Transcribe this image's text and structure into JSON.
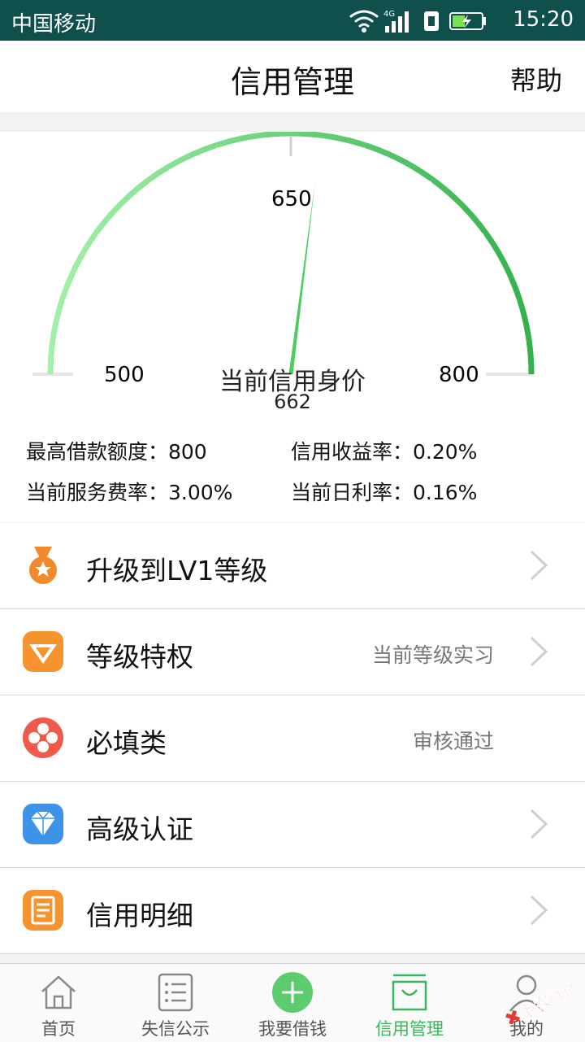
{
  "status_bar": {
    "carrier": "中国移动",
    "network": "4G",
    "time": "15:20"
  },
  "header": {
    "title": "信用管理",
    "help": "帮助"
  },
  "gauge": {
    "min_label": "500",
    "mid_label": "650",
    "max_label": "800",
    "min": 500,
    "max": 800,
    "value": 662,
    "center_label": "当前信用身价",
    "center_value": "662",
    "colors": {
      "start": "#a3f0a8",
      "end": "#33b24c",
      "track": "#e6e6e6"
    }
  },
  "stats": {
    "max_loan": "最高借款额度：800",
    "credit_yield": "信用收益率：0.20%",
    "service_fee": "当前服务费率：3.00%",
    "daily_rate": "当前日利率：0.16%"
  },
  "menu": [
    {
      "label": "升级到LV1等级",
      "status": "",
      "icon": "medal-icon",
      "chevron": true
    },
    {
      "label": "等级特权",
      "status": "当前等级实习",
      "icon": "vip-icon",
      "chevron": true
    },
    {
      "label": "必填类",
      "status": "审核通过",
      "icon": "clover-icon",
      "chevron": false
    },
    {
      "label": "高级认证",
      "status": "",
      "icon": "diamond-icon",
      "chevron": true
    },
    {
      "label": "信用明细",
      "status": "",
      "icon": "document-icon",
      "chevron": true
    }
  ],
  "tabs": [
    {
      "label": "首页",
      "icon": "home-icon"
    },
    {
      "label": "失信公示",
      "icon": "list-icon"
    },
    {
      "label": "我要借钱",
      "icon": "plus-icon"
    },
    {
      "label": "信用管理",
      "icon": "bag-icon",
      "active": true
    },
    {
      "label": "我的",
      "icon": "user-icon"
    }
  ],
  "watermark": "卡农社区"
}
